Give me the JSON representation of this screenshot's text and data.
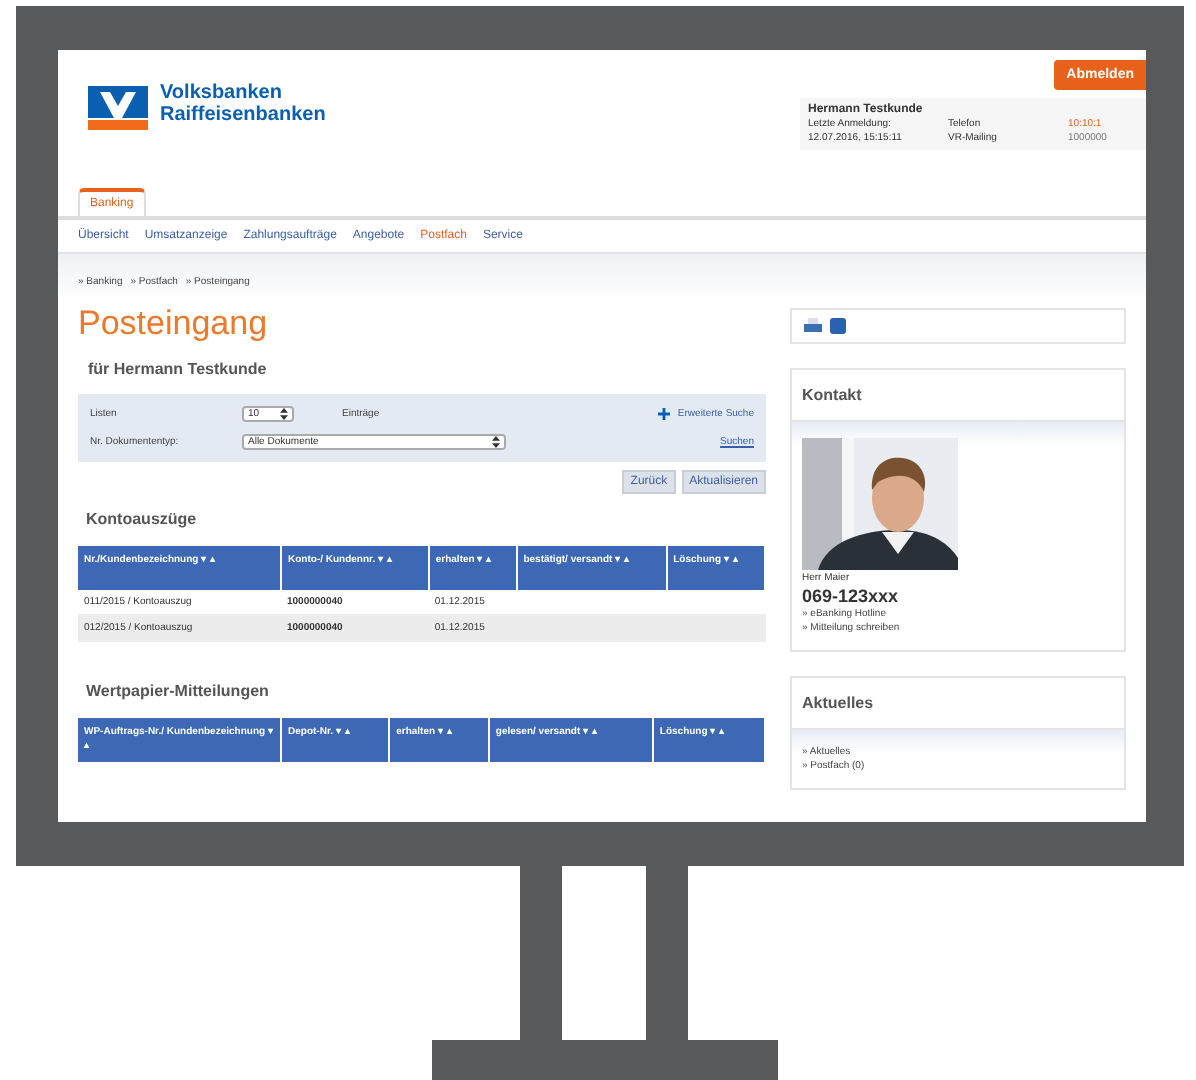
{
  "header": {
    "brand_lines": [
      "Volksbanken",
      "Raiffeisenbanken"
    ],
    "logout_button": "Abmelden",
    "user": {
      "name": "Hermann Testkunde",
      "rows": [
        [
          "Letzte Anmeldung:",
          "Telefon",
          "10:10:1"
        ],
        [
          "12.07.2016, 15:15:11",
          "VR-Mailing",
          "1000000"
        ]
      ]
    }
  },
  "tabs": [
    {
      "label": "Banking",
      "selected": true
    }
  ],
  "nav": [
    {
      "label": "Übersicht",
      "selected": false
    },
    {
      "label": "Umsatzanzeige",
      "selected": false
    },
    {
      "label": "Zahlungsaufträge",
      "selected": false
    },
    {
      "label": "Angebote",
      "selected": false
    },
    {
      "label": "Postfach",
      "selected": true
    },
    {
      "label": "Service",
      "selected": false
    }
  ],
  "breadcrumb": [
    "» Banking",
    "» Postfach",
    "» Posteingang"
  ],
  "title": "Posteingang",
  "subtitle": "für Hermann Testkunde",
  "filter": {
    "list_label": "Listen",
    "list_value": "10",
    "entries_label": "Einträge",
    "advanced_search": "Erweiterte Suche",
    "type_label": "Nr. Dokumententyp:",
    "type_value": "Alle Dokumente",
    "search_link": "Suchen"
  },
  "buttons": [
    "Zurück",
    "Aktualisieren"
  ],
  "sections": [
    {
      "title": "Kontoauszüge",
      "columns": [
        "Nr./Kundenbezeichnung ▾ ▴",
        "Konto-/ Kundennr. ▾ ▴",
        "erhalten ▾ ▴",
        "bestätigt/ versandt ▾ ▴",
        "Löschung ▾ ▴"
      ],
      "rows": [
        [
          "011/2015 / Kontoauszug",
          "1000000040",
          "01.12.2015"
        ],
        [
          "012/2015 / Kontoauszug",
          "1000000040",
          "01.12.2015"
        ]
      ]
    },
    {
      "title": "Wertpapier-Mitteilungen",
      "columns": [
        "WP-Auftrags-Nr./ Kundenbezeichnung ▾ ▴",
        "Depot-Nr. ▾ ▴",
        "erhalten ▾ ▴",
        "gelesen/ versandt ▾ ▴",
        "Löschung ▾ ▴"
      ]
    }
  ],
  "contact": {
    "title": "Kontakt",
    "name": "Herr Maier",
    "phone": "069-123xxx",
    "links": [
      "» eBanking Hotline",
      "» Mitteilung schreiben"
    ]
  },
  "news": {
    "title": "Aktuelles",
    "links": [
      "» Aktuelles",
      "» Postfach (0)"
    ]
  }
}
